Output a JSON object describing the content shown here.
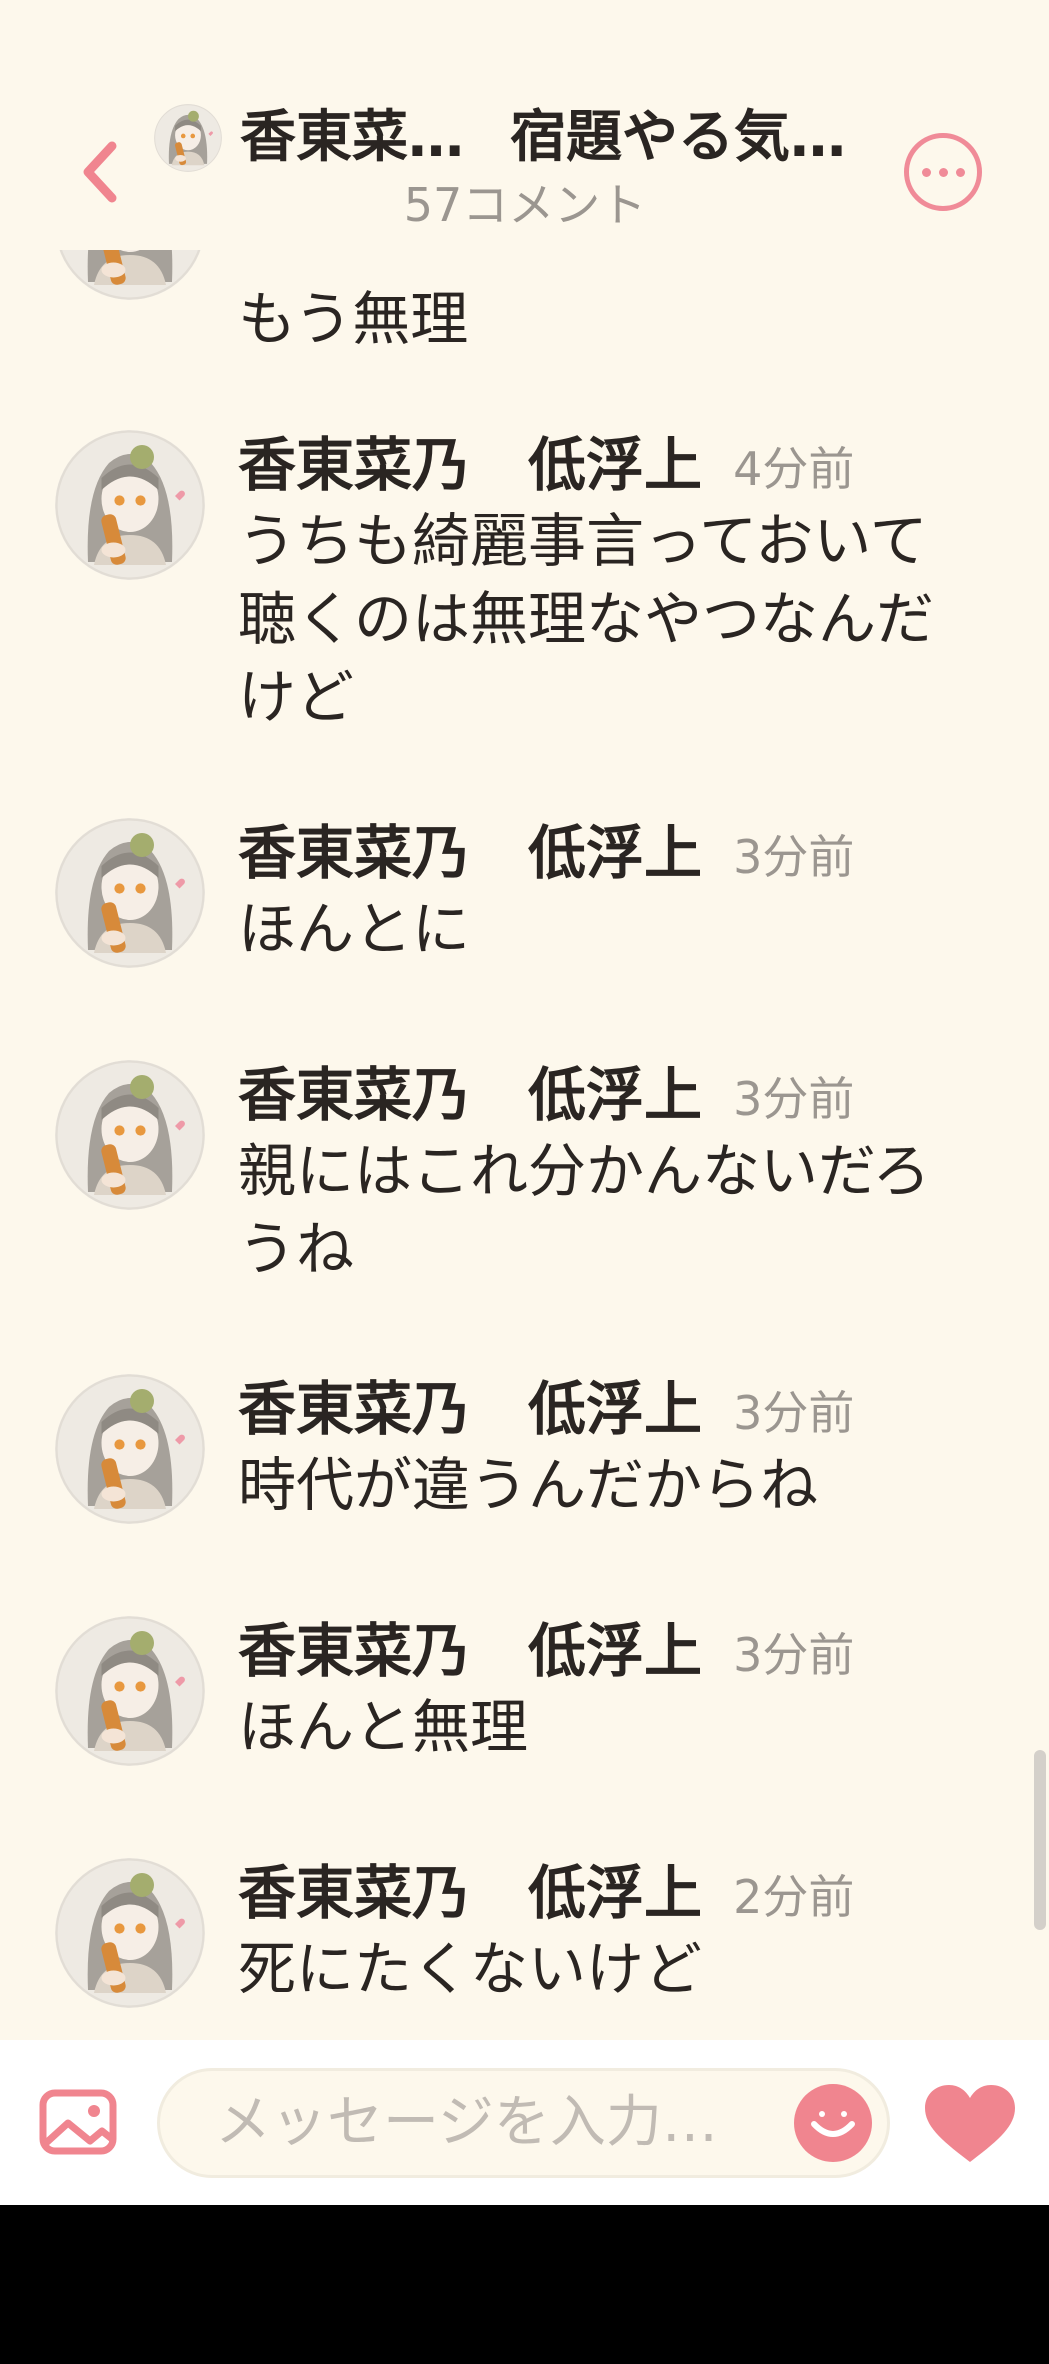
{
  "header": {
    "room_owner": "香東菜…",
    "room_title": "宿題やる気…",
    "comment_count": "57コメント"
  },
  "partial_message": {
    "text": "もう無理"
  },
  "messages": [
    {
      "author": "香東菜乃　低浮上",
      "time": "4分前",
      "text": "うちも綺麗事言っておいて聴くのは無理なやつなんだけど"
    },
    {
      "author": "香東菜乃　低浮上",
      "time": "3分前",
      "text": "ほんとに"
    },
    {
      "author": "香東菜乃　低浮上",
      "time": "3分前",
      "text": "親にはこれ分かんないだろうね"
    },
    {
      "author": "香東菜乃　低浮上",
      "time": "3分前",
      "text": "時代が違うんだからね"
    },
    {
      "author": "香東菜乃　低浮上",
      "time": "3分前",
      "text": "ほんと無理"
    },
    {
      "author": "香東菜乃　低浮上",
      "time": "2分前",
      "text": "死にたくないけど"
    }
  ],
  "input": {
    "placeholder": "メッセージを入力…"
  },
  "colors": {
    "background": "#fdf8ec",
    "accent": "#f0858f",
    "text": "#2a2522",
    "muted": "#9b9690"
  },
  "icons": [
    "back-chevron-icon",
    "more-icon",
    "image-icon",
    "emoji-icon",
    "heart-icon"
  ]
}
